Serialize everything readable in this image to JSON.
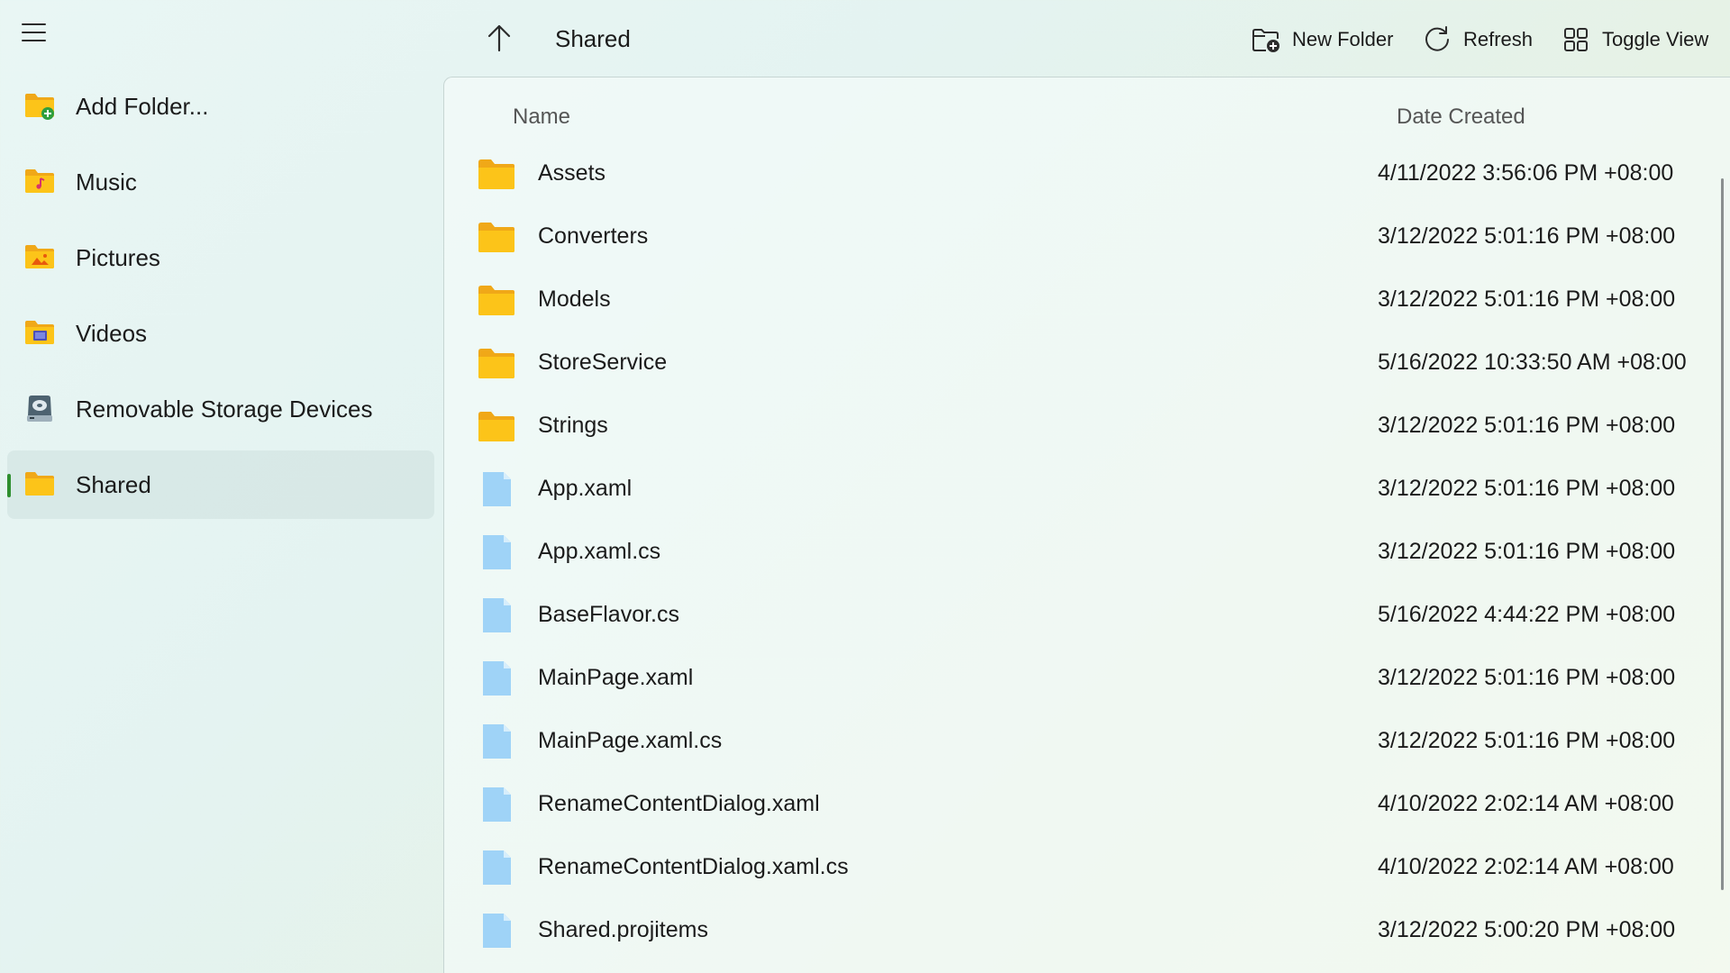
{
  "sidebar": {
    "items": [
      {
        "label": "Add Folder...",
        "icon": "add-folder-icon",
        "selected": false
      },
      {
        "label": "Music",
        "icon": "music-folder-icon",
        "selected": false
      },
      {
        "label": "Pictures",
        "icon": "pictures-folder-icon",
        "selected": false
      },
      {
        "label": "Videos",
        "icon": "videos-folder-icon",
        "selected": false
      },
      {
        "label": "Removable Storage Devices",
        "icon": "removable-drive-icon",
        "selected": false
      },
      {
        "label": "Shared",
        "icon": "folder-icon",
        "selected": true
      }
    ]
  },
  "toolbar": {
    "location": "Shared",
    "new_folder_label": "New Folder",
    "refresh_label": "Refresh",
    "toggle_view_label": "Toggle View"
  },
  "list": {
    "columns": {
      "name": "Name",
      "date": "Date Created"
    },
    "rows": [
      {
        "name": "Assets",
        "date": "4/11/2022 3:56:06 PM +08:00",
        "type": "folder"
      },
      {
        "name": "Converters",
        "date": "3/12/2022 5:01:16 PM +08:00",
        "type": "folder"
      },
      {
        "name": "Models",
        "date": "3/12/2022 5:01:16 PM +08:00",
        "type": "folder"
      },
      {
        "name": "StoreService",
        "date": "5/16/2022 10:33:50 AM +08:00",
        "type": "folder"
      },
      {
        "name": "Strings",
        "date": "3/12/2022 5:01:16 PM +08:00",
        "type": "folder"
      },
      {
        "name": "App.xaml",
        "date": "3/12/2022 5:01:16 PM +08:00",
        "type": "file"
      },
      {
        "name": "App.xaml.cs",
        "date": "3/12/2022 5:01:16 PM +08:00",
        "type": "file"
      },
      {
        "name": "BaseFlavor.cs",
        "date": "5/16/2022 4:44:22 PM +08:00",
        "type": "file"
      },
      {
        "name": "MainPage.xaml",
        "date": "3/12/2022 5:01:16 PM +08:00",
        "type": "file"
      },
      {
        "name": "MainPage.xaml.cs",
        "date": "3/12/2022 5:01:16 PM +08:00",
        "type": "file"
      },
      {
        "name": "RenameContentDialog.xaml",
        "date": "4/10/2022 2:02:14 AM +08:00",
        "type": "file"
      },
      {
        "name": "RenameContentDialog.xaml.cs",
        "date": "4/10/2022 2:02:14 AM +08:00",
        "type": "file"
      },
      {
        "name": "Shared.projitems",
        "date": "3/12/2022 5:00:20 PM +08:00",
        "type": "file"
      }
    ]
  },
  "colors": {
    "folder": "#fcc419",
    "folder_back": "#f0a818",
    "file": "#9fd3f7",
    "accent_indicator": "#2f8f2f"
  }
}
